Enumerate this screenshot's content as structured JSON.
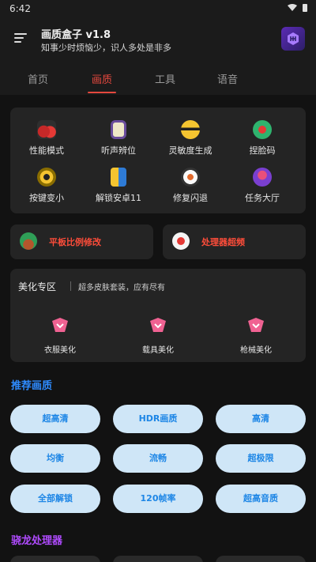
{
  "status_bar": {
    "time": "6:42"
  },
  "app": {
    "title": "画质盒子 v1.8",
    "subtitle": "知事少时烦恼少，识人多处是非多"
  },
  "tabs": [
    {
      "label": "首页",
      "active": false
    },
    {
      "label": "画质",
      "active": true
    },
    {
      "label": "工具",
      "active": false
    },
    {
      "label": "语音",
      "active": false
    }
  ],
  "feature_grid": [
    {
      "label": "性能模式",
      "icon": "cherries-icon"
    },
    {
      "label": "听声辨位",
      "icon": "gameboy-icon"
    },
    {
      "label": "灵敏度生成",
      "icon": "face-icon"
    },
    {
      "label": "捏脸码",
      "icon": "phone-icon"
    },
    {
      "label": "按键变小",
      "icon": "eye-icon"
    },
    {
      "label": "解锁安卓11",
      "icon": "phone-stack-icon"
    },
    {
      "label": "修复闪退",
      "icon": "sushi-icon"
    },
    {
      "label": "任务大厅",
      "icon": "arcade-icon"
    }
  ],
  "quick_actions": [
    {
      "label": "平板比例修改",
      "icon": "plant-pot-icon"
    },
    {
      "label": "处理器超频",
      "icon": "chip-icon"
    }
  ],
  "beauty_zone": {
    "title": "美化专区",
    "subtitle": "超多皮肤套装，应有尽有",
    "items": [
      {
        "label": "衣服美化",
        "icon": "skin-icon"
      },
      {
        "label": "载具美化",
        "icon": "skin-icon"
      },
      {
        "label": "枪械美化",
        "icon": "skin-icon"
      }
    ]
  },
  "recommended": {
    "title": "推荐画质",
    "options": [
      "超高清",
      "HDR画质",
      "高清",
      "均衡",
      "流畅",
      "超极限",
      "全部解锁",
      "120帧率",
      "超高音质"
    ]
  },
  "snapdragon": {
    "title": "骁龙处理器"
  },
  "colors": {
    "background": "#121212",
    "card": "#242424",
    "accent_red": "#e5483e",
    "accent_blue": "#2e8bff",
    "pill_bg": "#cfe6f7",
    "accent_purple": "#b04bff"
  }
}
